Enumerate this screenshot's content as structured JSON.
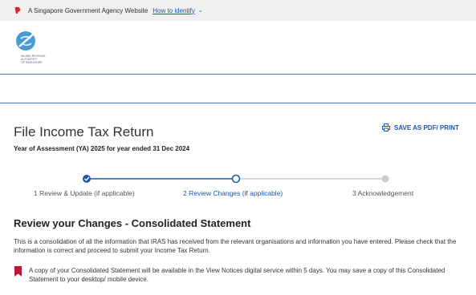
{
  "gov_banner": {
    "agency_text": "A Singapore Government Agency Website",
    "identify_link": "How to identify",
    "chevron": "⌄"
  },
  "logo": {
    "lines": [
      "INLAND REVENUE",
      "AUTHORITY",
      "OF SINGAPORE"
    ]
  },
  "page": {
    "title": "File Income Tax Return",
    "year_of_assessment": "Year of Assessment (YA) 2025 for year ended 31 Dec 2024",
    "save_label": "SAVE AS PDF/ PRINT"
  },
  "stepper": {
    "current_step": 2,
    "steps": [
      {
        "label": "1 Review & Update (if applicable)",
        "state": "completed"
      },
      {
        "label": "2 Review Changes (if applicable)",
        "state": "current"
      },
      {
        "label": "3 Acknowledgement",
        "state": "upcoming"
      }
    ]
  },
  "review": {
    "heading": "Review your Changes - Consolidated Statement",
    "paragraph": "This is a consolidation of all the information that IRAS has received from the relevant organisations and information you have entered. Please check that the information is correct and proceed to submit your Income Tax Return.",
    "notice": "A copy of your Consolidated Statement will be available in the View Notices digital service within 5 days. You may save a copy of this Consolidated Statement to your desktop/ mobile device."
  },
  "colors": {
    "accent": "#1a56a8",
    "banner_bg": "#f0f0f0",
    "notice_icon": "#c0163a",
    "step_upcoming": "#cccccc"
  }
}
